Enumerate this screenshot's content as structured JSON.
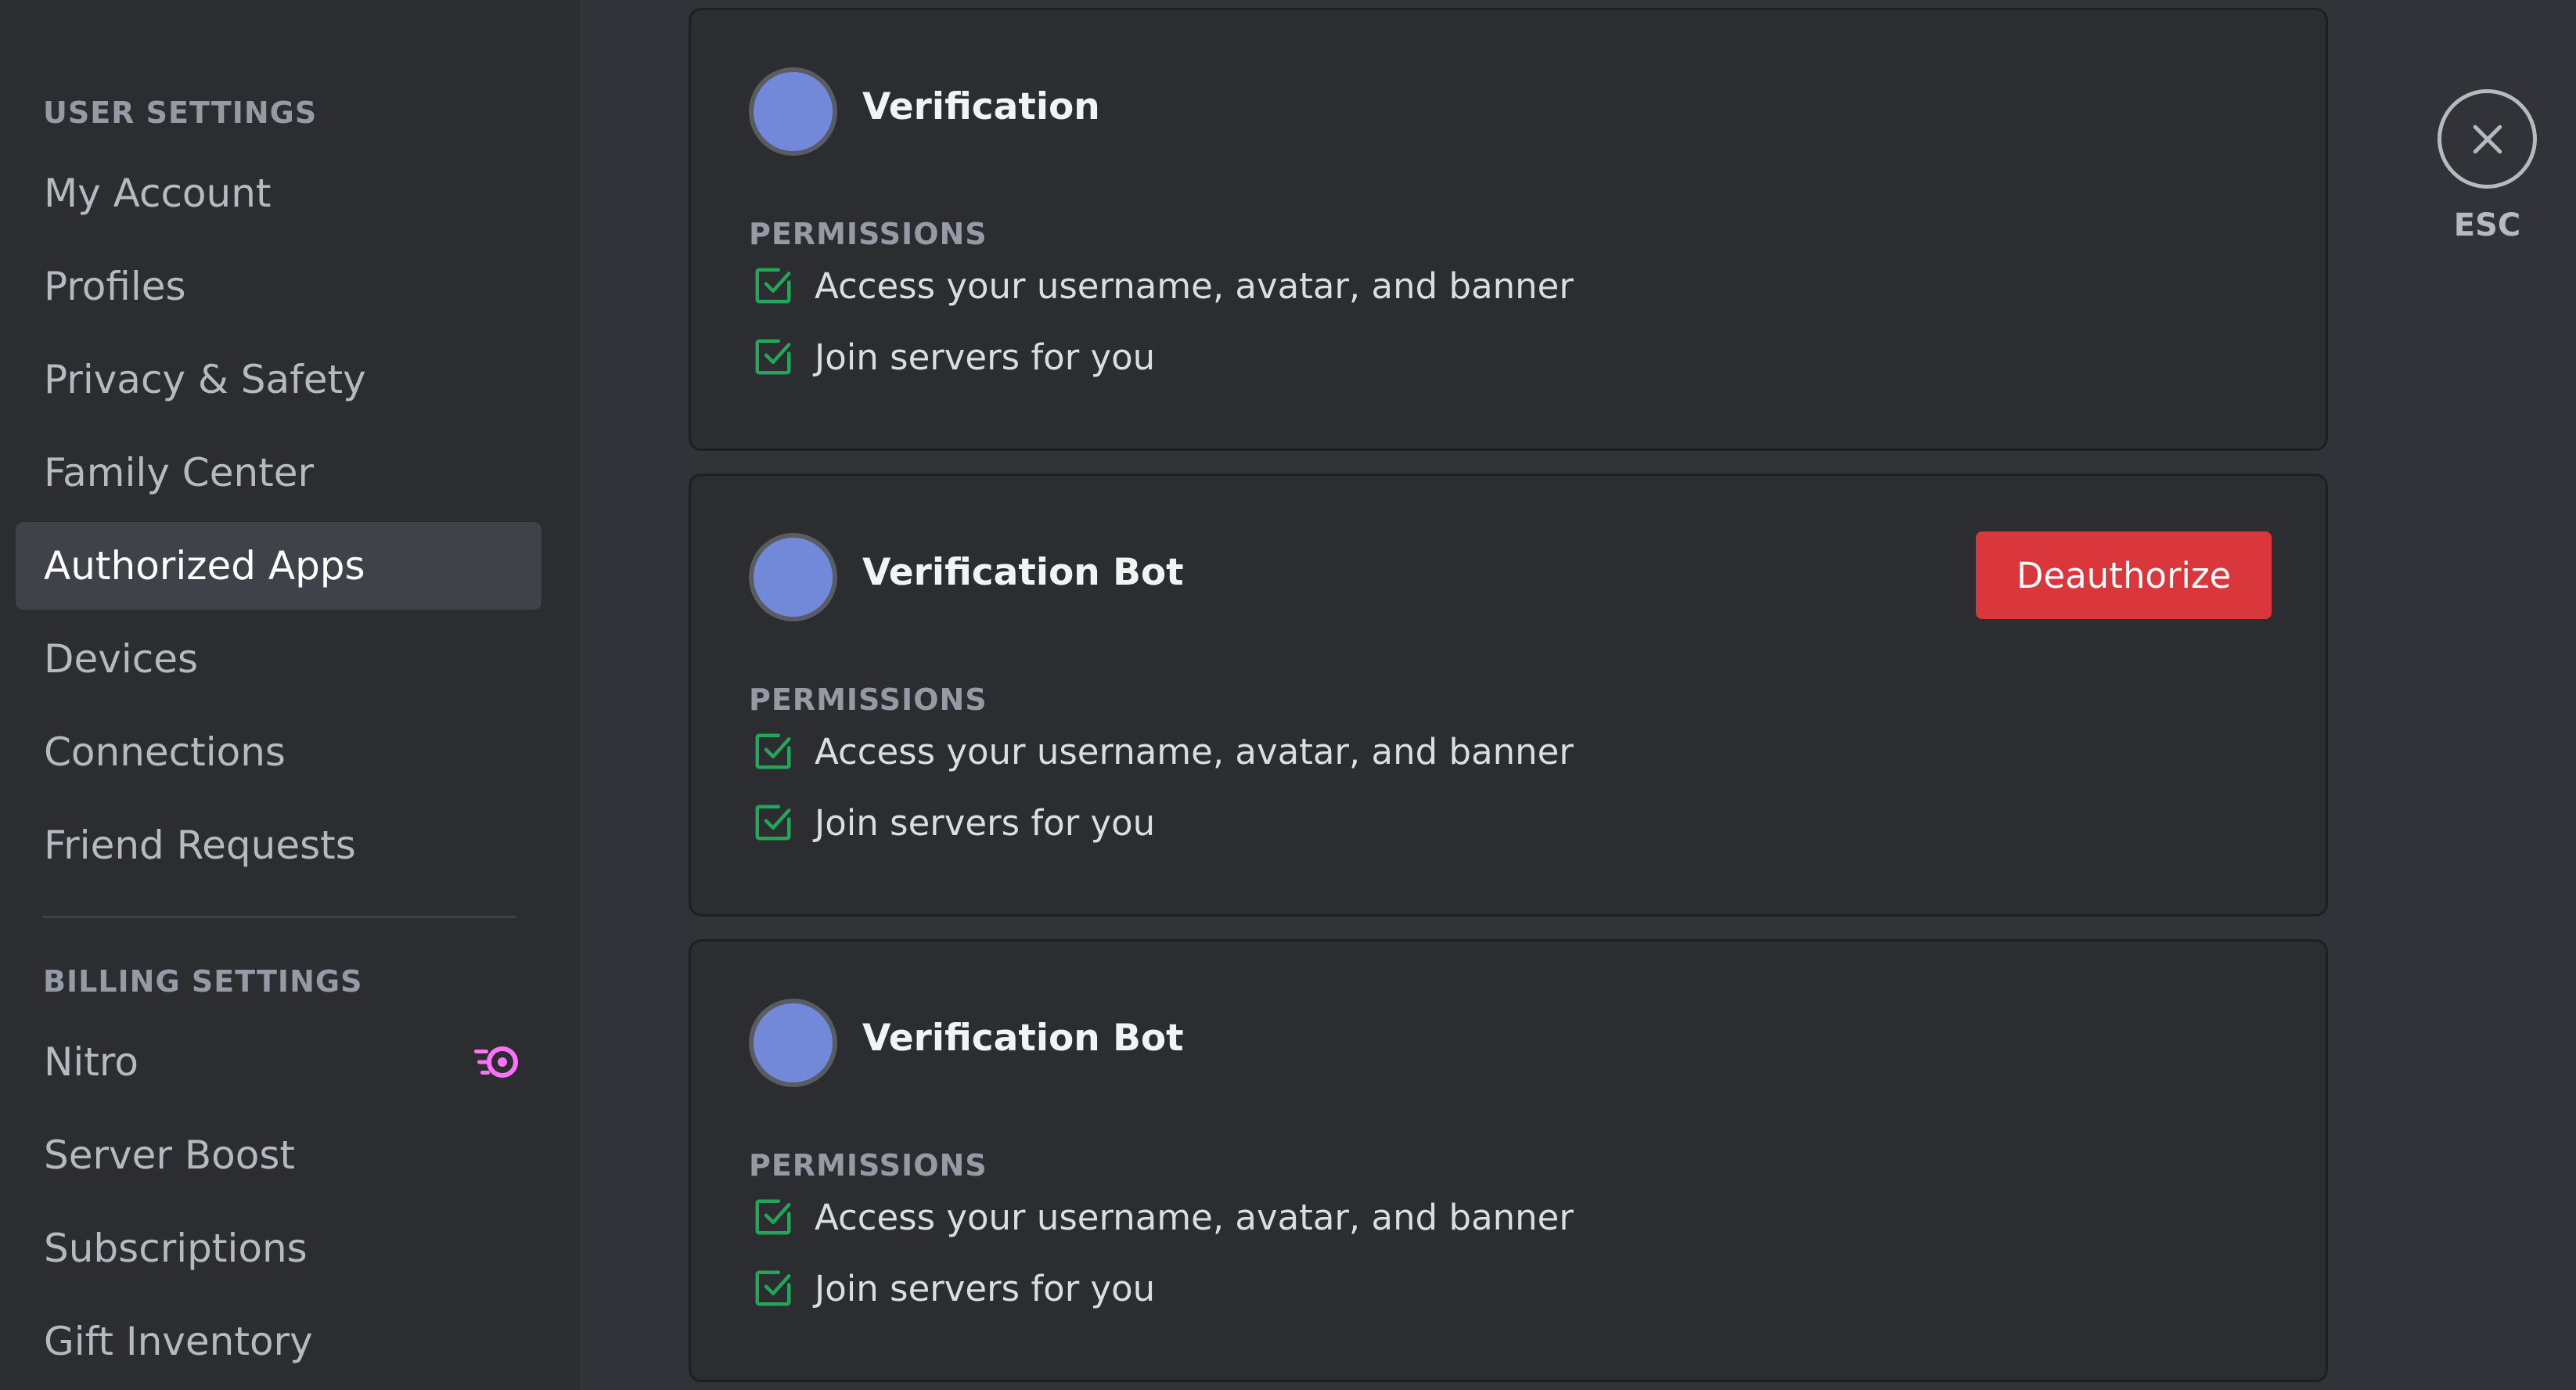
{
  "sidebar": {
    "user_settings_header": "USER SETTINGS",
    "user_items": [
      {
        "label": "My Account"
      },
      {
        "label": "Profiles"
      },
      {
        "label": "Privacy & Safety"
      },
      {
        "label": "Family Center"
      },
      {
        "label": "Authorized Apps",
        "selected": true
      },
      {
        "label": "Devices"
      },
      {
        "label": "Connections"
      },
      {
        "label": "Friend Requests"
      }
    ],
    "billing_settings_header": "BILLING SETTINGS",
    "billing_items": [
      {
        "label": "Nitro",
        "icon": "nitro-icon"
      },
      {
        "label": "Server Boost"
      },
      {
        "label": "Subscriptions"
      },
      {
        "label": "Gift Inventory"
      }
    ]
  },
  "apps": [
    {
      "name": "Verification",
      "permissions_header": "PERMISSIONS",
      "permissions": [
        "Access your username, avatar, and banner",
        "Join servers for you"
      ]
    },
    {
      "name": "Verification Bot",
      "deauthorize_label": "Deauthorize",
      "permissions_header": "PERMISSIONS",
      "permissions": [
        "Access your username, avatar, and banner",
        "Join servers for you"
      ]
    },
    {
      "name": "Verification Bot",
      "permissions_header": "PERMISSIONS",
      "permissions": [
        "Access your username, avatar, and banner",
        "Join servers for you"
      ]
    }
  ],
  "close": {
    "esc_label": "ESC"
  },
  "colors": {
    "background": "#313338",
    "sidebar": "#2b2d31",
    "selected_item": "#404249",
    "deauthorize": "#da373c",
    "check_green": "#23a55a",
    "nitro_accent": "#ff73fa",
    "avatar": "#7289da"
  }
}
